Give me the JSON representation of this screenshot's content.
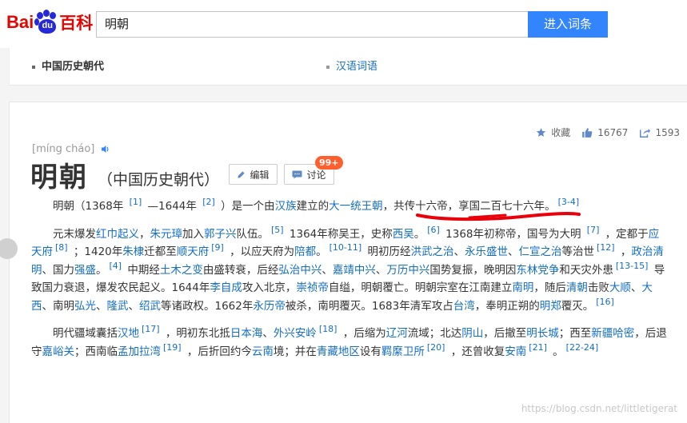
{
  "logo": {
    "brand_a": "Bai",
    "brand_du": "du",
    "brand_b": "百科"
  },
  "search": {
    "value": "明朝",
    "button": "进入词条"
  },
  "nav": {
    "active": "中国历史朝代",
    "other": "汉语词语"
  },
  "actions": {
    "collect": "收藏",
    "likes": "16767",
    "shares": "1593"
  },
  "entry": {
    "pinyin": "[míng cháo]",
    "title": "明朝",
    "subtitle": "（中国历史朝代）",
    "edit_label": "编辑",
    "discuss_label": "讨论",
    "discuss_badge": "99+"
  },
  "p1": {
    "t1": "明朝（1368年 ",
    "s1": "[1]",
    "t2": " —1644年 ",
    "s2": "[2]",
    "t3": " ）是一个由",
    "l1": "汉族",
    "t4": "建立的",
    "l2": "大一统王朝",
    "t5": "，共传十六帝，享国二百七十六年。",
    "s3": "[3-4]"
  },
  "p2": {
    "t1": "元末爆发",
    "l1": "红巾起义",
    "t2": "，",
    "l2": "朱元璋",
    "t3": "加入",
    "l3": "郭子兴",
    "t4": "队伍。",
    "s1": "[5]",
    "t5": " 1364年称吴王，史称",
    "l4": "西吴",
    "t6": "。",
    "s2": "[6]",
    "t7": " 1368年初称帝，国号为大明 ",
    "s3": "[7]",
    "t8": " ，定都于",
    "l5": "应天府",
    "s4": "[8]",
    "t9": " ；1420年",
    "l6": "朱棣",
    "t10": "迁都至",
    "l7": "顺天府",
    "s5": "[9]",
    "t11": " ，以应天府为",
    "l8": "陪都",
    "t12": "。",
    "s6": "[10-11]",
    "t13": " 明初历经",
    "l9": "洪武之治",
    "t14": "、",
    "l10": "永乐盛世",
    "t15": "、",
    "l11": "仁宣之治",
    "t16": "等治世",
    "s7": "[12]",
    "t17": " ，",
    "l12": "政治清明",
    "t18": "、国力",
    "l13": "强盛",
    "t19": "。",
    "s8": "[4]",
    "t20": " 中期经",
    "l14": "土木之变",
    "t21": "由盛转衰，后经",
    "l15": "弘治中兴",
    "t22": "、",
    "l16": "嘉靖中兴",
    "t23": "、",
    "l17": "万历中兴",
    "t24": "国势复振，晚明因",
    "l18": "东林党争",
    "t25": "和天灾外患",
    "s9": "[13-15]",
    "t26": " 导致国力衰退，爆发农民起义。1644年",
    "l19": "李自成",
    "t27": "攻入北京，",
    "l20": "崇祯帝",
    "t28": "自缢，明朝覆亡。明朝宗室在江南建立",
    "l21": "南明",
    "t29": "，随后",
    "l22": "清朝",
    "t30": "击败",
    "l23": "大顺",
    "t31": "、",
    "l24": "大西",
    "t32": "、南明",
    "l25": "弘光",
    "t33": "、",
    "l26": "隆武",
    "t34": "、",
    "l27": "绍武",
    "t35": "等诸政权。1662年",
    "l28": "永历帝",
    "t36": "被杀，南明覆灭。1683年清军攻占",
    "l29": "台湾",
    "t37": "，奉明正朔的",
    "l30": "明郑",
    "t38": "覆灭。",
    "s10": "[16]"
  },
  "p3": {
    "t1": "明代疆域囊括",
    "l1": "汉地",
    "s1": "[17]",
    "t2": " ，明初东北抵",
    "l2": "日本海",
    "t3": "、",
    "l3": "外兴安岭",
    "s2": "[18]",
    "t4": " ，后缩为",
    "l4": "辽河",
    "t5": "流域；北达",
    "l5": "阴山",
    "t6": "，后撤至",
    "l6": "明长城",
    "t7": "；西至",
    "l7": "新疆哈密",
    "t8": "，后退守",
    "l8": "嘉峪关",
    "t9": "；西南临",
    "l9": "孟加拉湾",
    "s3": "[19]",
    "t10": " ，后折回约今",
    "l10": "云南",
    "t11": "境；并在",
    "l11": "青藏地区",
    "t12": "设有",
    "l12": "羁縻卫所",
    "s4": "[20]",
    "t13": " ，还曾收复",
    "l13": "安南",
    "s5": "[21]",
    "t14": " 。",
    "s6": "[22-24]"
  },
  "watermark": "https://blog.csdn.net/littletigerat",
  "colors": {
    "link": "#136ec2",
    "accent": "#3385ff",
    "brand_red": "#e10601",
    "brand_blue": "#2529d8",
    "badge": "#ff5e2e",
    "annotation": "#e8000b"
  }
}
